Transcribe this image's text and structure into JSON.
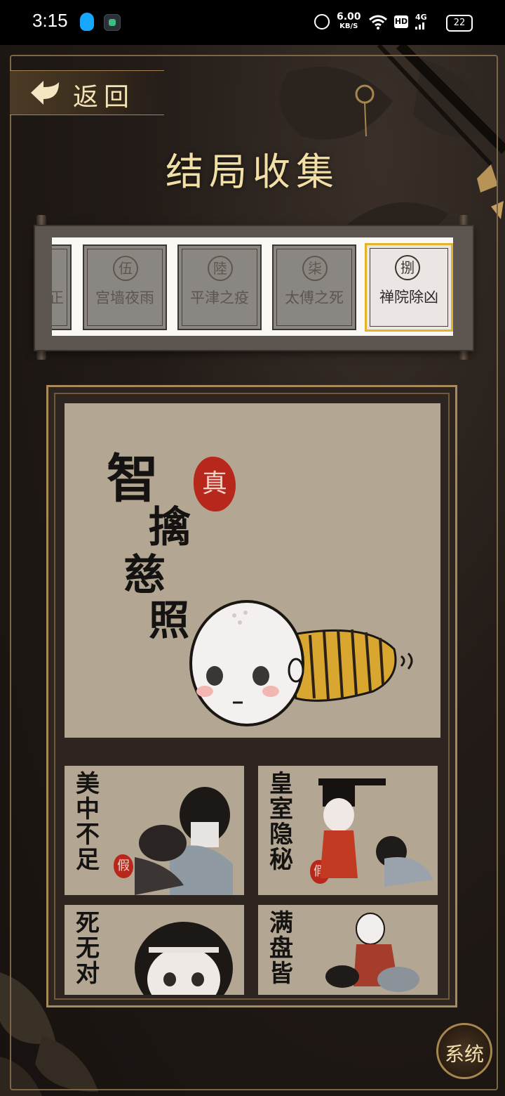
{
  "status_bar": {
    "time": "3:15",
    "net_speed": "6.00",
    "net_unit": "KB/S",
    "hd": "HD",
    "network": "4G",
    "battery": "22"
  },
  "header": {
    "back_label": "返回",
    "title": "结局收集"
  },
  "ending_tabs": [
    {
      "seal": "",
      "label": "…"
    },
    {
      "seal": "伍",
      "label": "宫墙夜雨"
    },
    {
      "seal": "陸",
      "label": "平津之疫"
    },
    {
      "seal": "柒",
      "label": "太傅之死"
    },
    {
      "seal": "捌",
      "label": "禅院除凶",
      "active": true
    }
  ],
  "main_ending": {
    "title_chars": [
      "智",
      "擒",
      "慈",
      "照"
    ],
    "stamp": "真"
  },
  "thumbnails": [
    {
      "title": "美中不足",
      "stamp": "假"
    },
    {
      "title": "皇室隐秘",
      "stamp": "假"
    },
    {
      "title": "死无对",
      "stamp": ""
    },
    {
      "title": "满盘皆",
      "stamp": ""
    }
  ],
  "system_button": "系统",
  "colors": {
    "gold": "#f2dfa6",
    "seal_red": "#b8271c",
    "active_border": "#e3b428",
    "paper": "#b3a692"
  }
}
